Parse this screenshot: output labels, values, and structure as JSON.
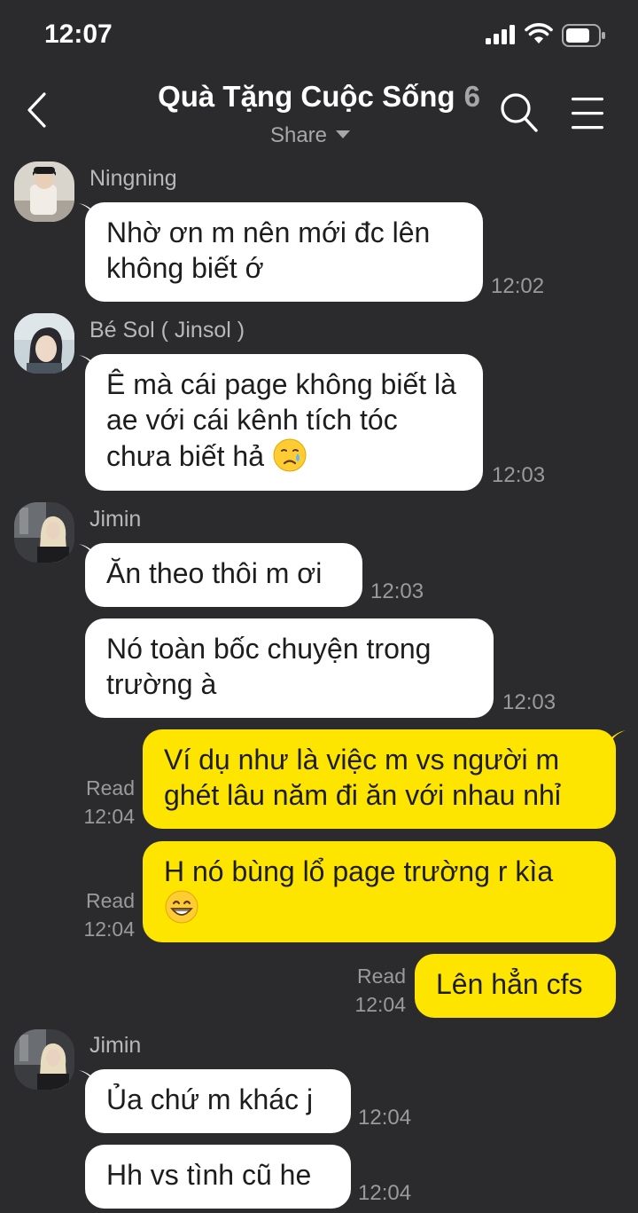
{
  "status": {
    "time": "12:07"
  },
  "header": {
    "title": "Quà Tặng Cuộc Sống",
    "member_count": "6",
    "subtitle": "Share"
  },
  "messages": [
    {
      "sender": "Ningning",
      "text": "Nhờ ơn m nên mới đc lên không biết ớ",
      "time": "12:02"
    },
    {
      "sender": "Bé Sol ( Jinsol )",
      "text": "Ê mà cái page không biết là ae với cái kênh tích tóc chưa biết hả",
      "time": "12:03",
      "emoji": "crying-face"
    },
    {
      "sender": "Jimin",
      "text": "Ăn theo thôi m ơi",
      "time": "12:03"
    },
    {
      "text": "Nó toàn bốc chuyện trong trường à",
      "time": "12:03"
    },
    {
      "mine": true,
      "text": "Ví dụ như là việc m vs người m ghét lâu năm đi ăn với nhau nhỉ",
      "read": "Read",
      "time": "12:04"
    },
    {
      "mine": true,
      "text": "H nó bùng lổ page trường r kìa",
      "read": "Read",
      "time": "12:04",
      "emoji": "grinning-face"
    },
    {
      "mine": true,
      "text": "Lên hẳn cfs",
      "read": "Read",
      "time": "12:04"
    },
    {
      "sender": "Jimin",
      "text": "Ủa chứ m khác j",
      "time": "12:04"
    },
    {
      "text": "Hh vs tình cũ he",
      "time": "12:04"
    }
  ],
  "colors": {
    "background": "#2b2b2d",
    "my_bubble": "#fee500",
    "their_bubble": "#ffffff"
  }
}
